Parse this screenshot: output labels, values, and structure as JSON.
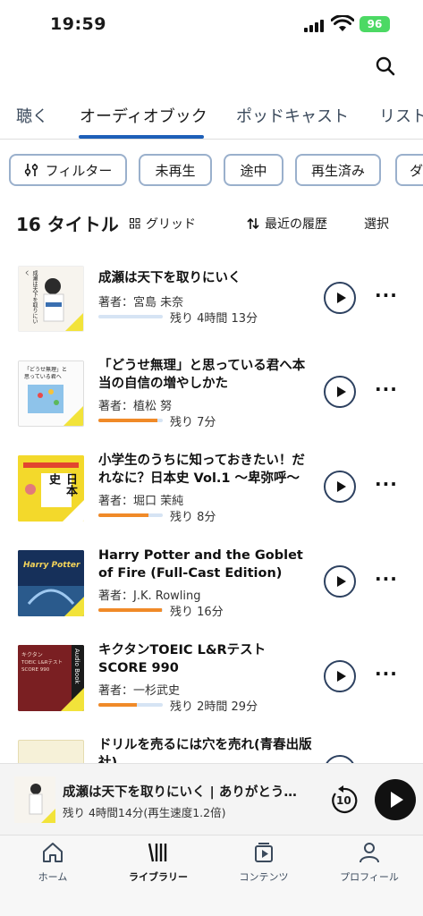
{
  "status": {
    "time": "19:59",
    "battery": "96"
  },
  "tabs": [
    {
      "label": "聴く"
    },
    {
      "label": "オーディオブック"
    },
    {
      "label": "ポッドキャスト"
    },
    {
      "label": "リスト"
    }
  ],
  "chips": [
    {
      "label": "フィルター"
    },
    {
      "label": "未再生"
    },
    {
      "label": "途中"
    },
    {
      "label": "再生済み"
    },
    {
      "label": "ダ"
    }
  ],
  "list_header": {
    "count": "16 タイトル",
    "grid_label": "グリッド",
    "sort_label": "最近の履歴",
    "select_label": "選択"
  },
  "books": [
    {
      "title": "成瀬は天下を取りにいく",
      "author": "著者：宮島 未奈",
      "remaining": "残り 4時間 13分",
      "progress": 0.0
    },
    {
      "title": "「どうせ無理」と思っている君へ本当の自信の増やしかた",
      "author": "著者：植松 努",
      "remaining": "残り 7分",
      "progress": 0.92
    },
    {
      "title": "小学生のうちに知っておきたい！だれなに？日本史 Vol.1 〜卑弥呼〜",
      "author": "著者：堀口 茉純",
      "remaining": "残り 8分",
      "progress": 0.78
    },
    {
      "title": "Harry Potter and the Goblet of Fire (Full-Cast Edition)",
      "author": "著者：J.K. Rowling",
      "remaining": "残り 16分",
      "progress": 0.98
    },
    {
      "title": "キクタンTOEIC L&Rテスト SCORE 990",
      "author": "著者：一杉武史",
      "remaining": "残り 2時間 29分",
      "progress": 0.6
    },
    {
      "title": "ドリルを売るには穴を売れ(青春出版社)",
      "author": "",
      "remaining": "",
      "progress": 0.0
    }
  ],
  "cover_text": {
    "book1": "成瀬は天下を取りにいく",
    "book2": "「どうせ無理」と思っている君へ",
    "book3": "日本史",
    "book4": "Harry Potter",
    "book5_top": "キクタン",
    "book5_mid": "TOEIC L&Rテスト SCORE 990",
    "book5_side": "Audio Book"
  },
  "mini_player": {
    "title": "成瀬は天下を取りにいく | ありがとう…",
    "subtitle": "残り 4時間14分(再生速度1.2倍)",
    "skip": "10"
  },
  "tab_bar": [
    {
      "label": "ホーム",
      "icon": "home-icon"
    },
    {
      "label": "ライブラリー",
      "icon": "library-icon"
    },
    {
      "label": "コンテンツ",
      "icon": "content-icon"
    },
    {
      "label": "プロフィール",
      "icon": "profile-icon"
    }
  ],
  "colors": {
    "accent": "#1d5fb8",
    "progress": "#f08a28",
    "chip_border": "#9ab0cc"
  }
}
